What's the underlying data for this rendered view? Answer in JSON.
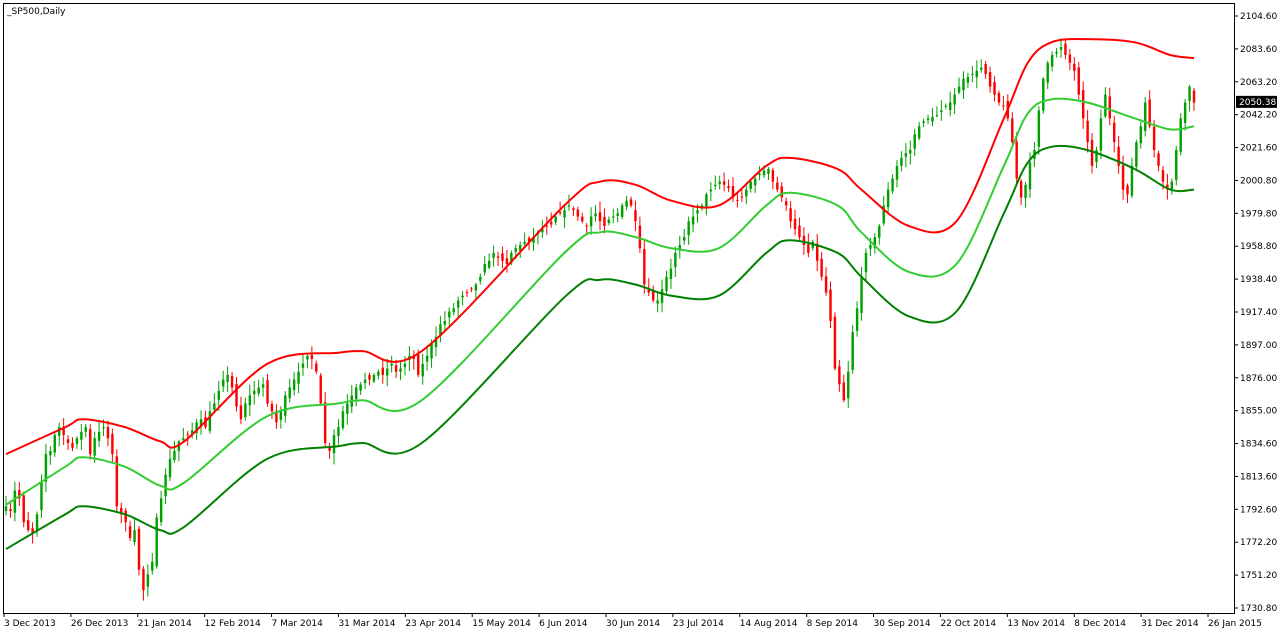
{
  "window": {
    "title": "_SP500,Daily"
  },
  "colors": {
    "background": "#ffffff",
    "frame": "#000000",
    "grid": "#000000",
    "bull_candle": "#00a000",
    "bear_candle": "#ff0000",
    "upper_band": "#ff0000",
    "middle_band": "#32cd32",
    "lower_band": "#008000",
    "current_price_bg": "#000000",
    "current_price_fg": "#ffffff"
  },
  "chart_data": {
    "type": "line",
    "chart_style": "candlestick with three envelope bands",
    "symbol_label": "_SP500,Daily",
    "ylim": [
      1730.8,
      2104.6
    ],
    "y_ticks": [
      "2104.60",
      "2083.60",
      "2063.20",
      "2042.20",
      "2021.60",
      "2000.80",
      "1979.80",
      "1958.80",
      "1938.40",
      "1917.40",
      "1897.00",
      "1876.00",
      "1855.00",
      "1834.60",
      "1813.60",
      "1792.60",
      "1772.20",
      "1751.20",
      "1730.80"
    ],
    "current_price": "2050.38",
    "x_ticks": [
      "3 Dec 2013",
      "26 Dec 2013",
      "21 Jan 2014",
      "12 Feb 2014",
      "7 Mar 2014",
      "31 Mar 2014",
      "23 Apr 2014",
      "15 May 2014",
      "6 Jun 2014",
      "30 Jun 2014",
      "23 Jul 2014",
      "14 Aug 2014",
      "8 Sep 2014",
      "30 Sep 2014",
      "22 Oct 2014",
      "13 Nov 2014",
      "8 Dec 2014",
      "31 Dec 2014",
      "26 Jan 2015"
    ],
    "grid": false,
    "series": [
      {
        "role": "price",
        "description": "approximate daily closes, 3 Dec 2013 to early Feb 2015",
        "close": [
          1795,
          1792,
          1805,
          1800,
          1785,
          1780,
          1778,
          1790,
          1810,
          1828,
          1830,
          1840,
          1845,
          1840,
          1835,
          1832,
          1838,
          1842,
          1845,
          1828,
          1838,
          1842,
          1845,
          1838,
          1828,
          1795,
          1790,
          1785,
          1775,
          1780,
          1755,
          1742,
          1752,
          1760,
          1788,
          1800,
          1815,
          1825,
          1830,
          1836,
          1838,
          1840,
          1843,
          1848,
          1850,
          1845,
          1855,
          1860,
          1868,
          1875,
          1878,
          1870,
          1858,
          1850,
          1860,
          1865,
          1868,
          1870,
          1872,
          1860,
          1855,
          1848,
          1855,
          1865,
          1870,
          1875,
          1880,
          1885,
          1890,
          1888,
          1880,
          1860,
          1835,
          1830,
          1840,
          1845,
          1855,
          1860,
          1865,
          1870,
          1872,
          1875,
          1875,
          1878,
          1880,
          1878,
          1882,
          1885,
          1880,
          1882,
          1885,
          1890,
          1888,
          1878,
          1885,
          1890,
          1898,
          1902,
          1910,
          1912,
          1918,
          1920,
          1925,
          1928,
          1930,
          1932,
          1935,
          1940,
          1948,
          1950,
          1955,
          1952,
          1950,
          1948,
          1955,
          1958,
          1960,
          1962,
          1962,
          1965,
          1968,
          1970,
          1972,
          1973,
          1978,
          1980,
          1982,
          1985,
          1982,
          1978,
          1975,
          1972,
          1978,
          1980,
          1975,
          1972,
          1976,
          1978,
          1980,
          1985,
          1988,
          1985,
          1975,
          1958,
          1935,
          1930,
          1925,
          1925,
          1932,
          1940,
          1945,
          1955,
          1960,
          1965,
          1975,
          1978,
          1982,
          1985,
          1992,
          1995,
          1998,
          2000,
          1998,
          1996,
          1990,
          1988,
          1990,
          1995,
          2000,
          2002,
          2005,
          2007,
          2008,
          2000,
          1995,
          1990,
          1985,
          1975,
          1970,
          1965,
          1960,
          1955,
          1962,
          1950,
          1940,
          1930,
          1912,
          1882,
          1872,
          1862,
          1880,
          1905,
          1920,
          1940,
          1955,
          1960,
          1965,
          1972,
          1985,
          1995,
          2002,
          2010,
          2015,
          2018,
          2020,
          2030,
          2035,
          2038,
          2040,
          2041,
          2042,
          2045,
          2048,
          2050,
          2055,
          2060,
          2065,
          2066,
          2068,
          2070,
          2072,
          2068,
          2060,
          2055,
          2050,
          2048,
          2040,
          2025,
          2002,
          1990,
          1998,
          2012,
          2020,
          2045,
          2065,
          2075,
          2080,
          2082,
          2085,
          2080,
          2075,
          2070,
          2055,
          2040,
          2025,
          2010,
          2020,
          2040,
          2055,
          2040,
          2025,
          2010,
          1995,
          1992,
          2010,
          2025,
          2035,
          2050,
          2035,
          2020,
          2010,
          2000,
          1995,
          2000,
          2020,
          2040,
          2050,
          2060,
          2050
        ]
      },
      {
        "role": "upper_band",
        "color": "#ff0000",
        "x": [
          0,
          0.05,
          0.065,
          0.1,
          0.13,
          0.15,
          0.22,
          0.28,
          0.3,
          0.35,
          0.47,
          0.5,
          0.53,
          0.56,
          0.6,
          0.64,
          0.66,
          0.7,
          0.72,
          0.76,
          0.8,
          0.84,
          0.86,
          0.88,
          0.91,
          0.95,
          0.98,
          1.0
        ],
        "values": [
          1828,
          1845,
          1850,
          1845,
          1836,
          1836,
          1885,
          1892,
          1893,
          1893,
          1985,
          2000,
          1998,
          1988,
          1985,
          2010,
          2015,
          2008,
          1995,
          1972,
          1975,
          2040,
          2075,
          2088,
          2090,
          2088,
          2080,
          2078
        ]
      },
      {
        "role": "middle_band",
        "color": "#32cd32",
        "x": [
          0,
          0.05,
          0.065,
          0.1,
          0.13,
          0.15,
          0.22,
          0.28,
          0.3,
          0.35,
          0.47,
          0.5,
          0.53,
          0.56,
          0.6,
          0.64,
          0.66,
          0.7,
          0.72,
          0.76,
          0.8,
          0.84,
          0.86,
          0.88,
          0.91,
          0.95,
          0.98,
          1.0
        ],
        "values": [
          1796,
          1820,
          1826,
          1820,
          1808,
          1810,
          1852,
          1860,
          1862,
          1862,
          1955,
          1968,
          1965,
          1958,
          1958,
          1985,
          1993,
          1985,
          1968,
          1943,
          1948,
          2010,
          2043,
          2052,
          2050,
          2040,
          2033,
          2035
        ]
      },
      {
        "role": "lower_band",
        "color": "#008000",
        "x": [
          0,
          0.05,
          0.065,
          0.1,
          0.13,
          0.15,
          0.22,
          0.28,
          0.3,
          0.35,
          0.47,
          0.5,
          0.53,
          0.56,
          0.6,
          0.64,
          0.66,
          0.7,
          0.72,
          0.76,
          0.8,
          0.84,
          0.86,
          0.88,
          0.91,
          0.95,
          0.98,
          1.0
        ],
        "values": [
          1768,
          1790,
          1795,
          1790,
          1780,
          1782,
          1825,
          1833,
          1835,
          1835,
          1927,
          1938,
          1935,
          1928,
          1928,
          1955,
          1963,
          1955,
          1940,
          1915,
          1918,
          1980,
          2012,
          2022,
          2020,
          2008,
          1995,
          1995
        ]
      }
    ]
  }
}
